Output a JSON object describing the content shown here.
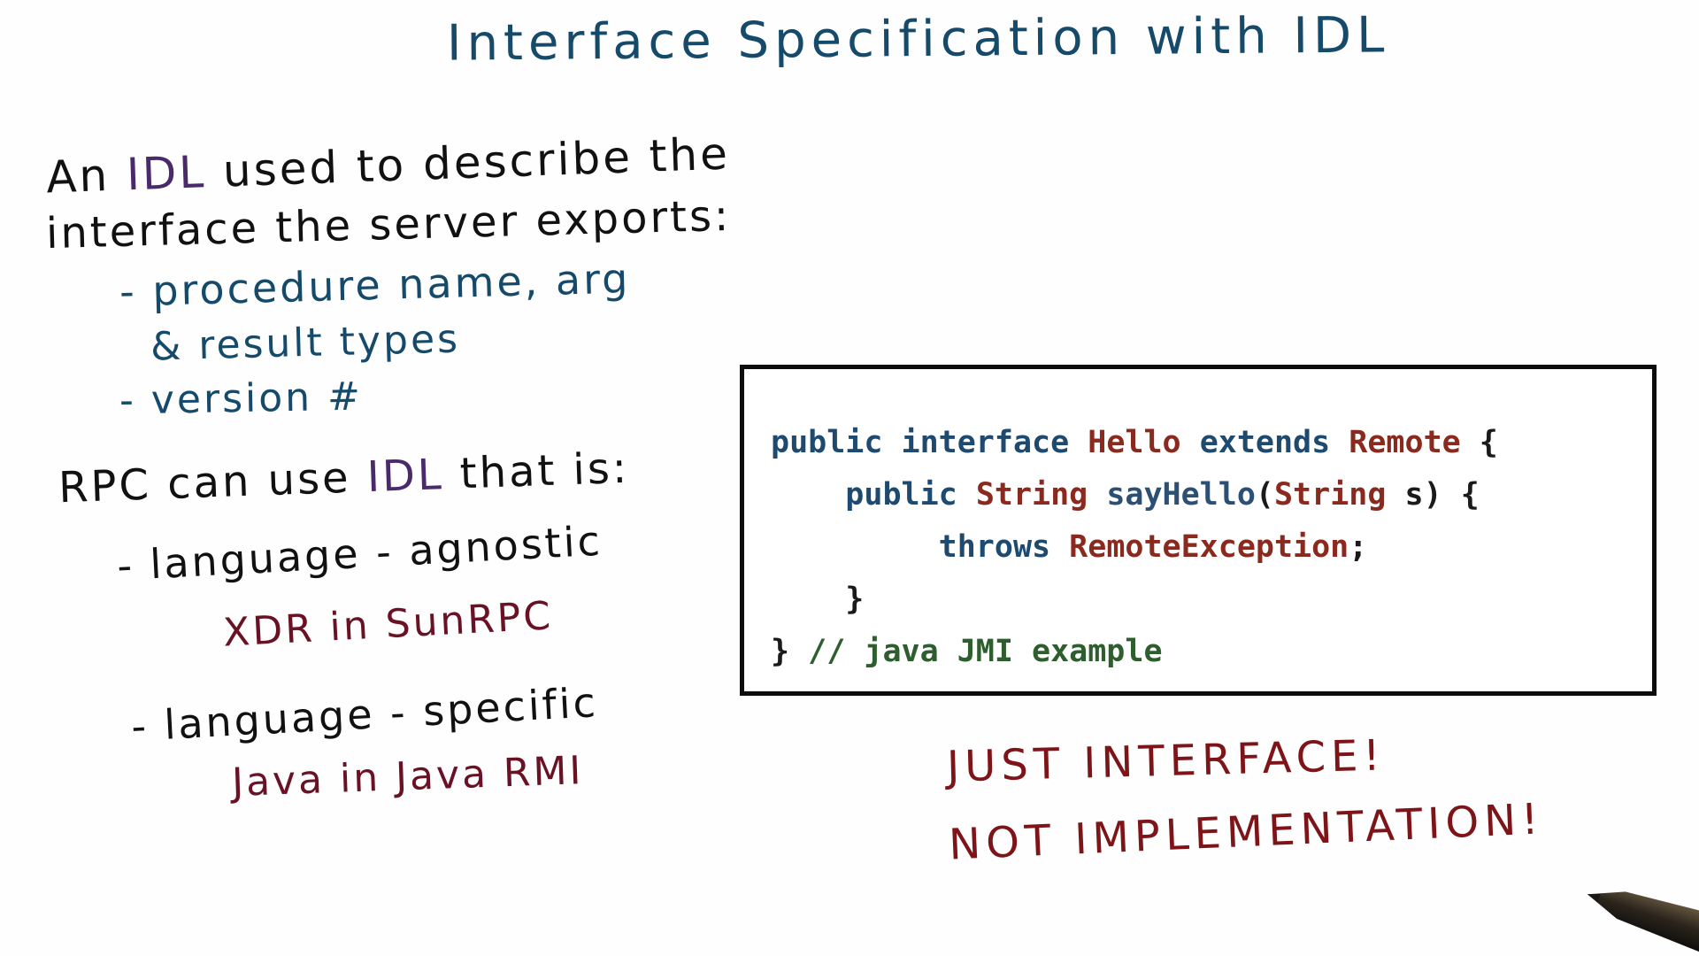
{
  "title": "Interface Specification with IDL",
  "left_notes": {
    "l1_a": "An",
    "l1_b": "IDL",
    "l1_c": "used to describe the",
    "l2": "interface the server exports:",
    "l3": "- procedure name, arg",
    "l4": "& result types",
    "l5": "- version #",
    "l6_a": "RPC can use",
    "l6_b": "IDL",
    "l6_c": "that is:",
    "l7": "- language - agnostic",
    "l8": "XDR in SunRPC",
    "l9": "- language - specific",
    "l10": "Java in Java RMI"
  },
  "code": {
    "kw_public": "public",
    "kw_interface": "interface",
    "type_hello": "Hello",
    "kw_extends": "extends",
    "type_remote": "Remote",
    "brace_open": "{",
    "type_string": "String",
    "fn_sayhello": "sayHello",
    "paren_open": "(",
    "param_s": "s",
    "paren_close_brace": ") {",
    "kw_throws": "throws",
    "type_exception": "RemoteException",
    "semicolon": ";",
    "brace_close": "}",
    "comment": "// java JMI example"
  },
  "notes_right": {
    "n1": "JUST INTERFACE!",
    "n2": "NOT IMPLEMENTATION!"
  },
  "colors": {
    "title": "#154a6b",
    "handwriting_black": "#111111",
    "handwriting_blue": "#154a6b",
    "handwriting_purple": "#4a2a6b",
    "handwriting_maroon": "#6a1225",
    "note_red": "#7d1418",
    "code_keyword": "#1d4a6e",
    "code_type": "#8a2a1e",
    "code_comment": "#2e5e2e"
  },
  "icons": {
    "pen": "pen-icon"
  }
}
